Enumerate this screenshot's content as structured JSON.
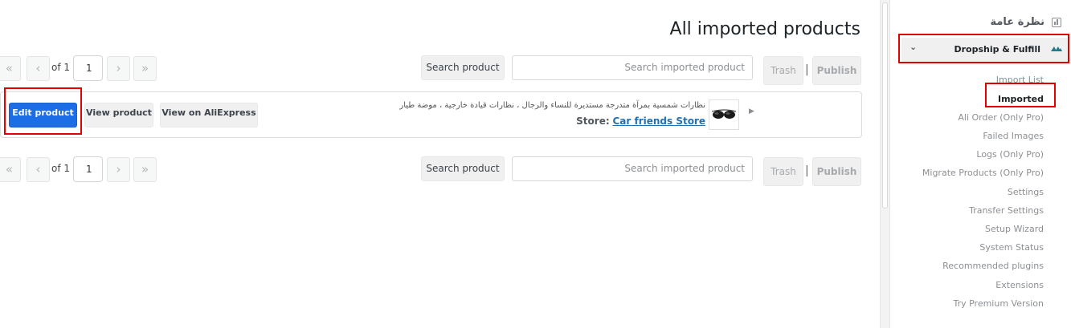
{
  "page": {
    "title": "All imported products"
  },
  "pagination": {
    "first": "«",
    "prev": "‹",
    "next": "›",
    "last": "»",
    "of_label": "of 1",
    "current_page": "1"
  },
  "toolbar": {
    "search_button": "Search product",
    "search_placeholder": "Search imported product",
    "trash_button": "Trash",
    "separator": "|",
    "publish_button": "Publish"
  },
  "product": {
    "title": "نظارات شمسية بمرآة متدرجة مستديرة للنساء والرجال ، نظارات قيادة خارجية ، موضة طيار",
    "store_label": "Store:",
    "store_name": "Car friends Store",
    "edit_button": "Edit product",
    "view_button": "View product",
    "aliexpress_button": "View on AliExpress",
    "thumbnail_icon": "sunglasses-image"
  },
  "sidebar": {
    "overview": "نظرة عامة",
    "plugin_menu": "Dropship & Fulfill",
    "items": [
      {
        "label": "Import List",
        "active": false
      },
      {
        "label": "Imported",
        "active": true
      },
      {
        "label": "Ali Order (Only Pro)",
        "active": false
      },
      {
        "label": "Failed Images",
        "active": false
      },
      {
        "label": "Logs (Only Pro)",
        "active": false
      },
      {
        "label": "Migrate Products (Only Pro)",
        "active": false
      },
      {
        "label": "Settings",
        "active": false
      },
      {
        "label": "Transfer Settings",
        "active": false
      },
      {
        "label": "Setup Wizard",
        "active": false
      },
      {
        "label": "System Status",
        "active": false
      },
      {
        "label": "Recommended plugins",
        "active": false
      },
      {
        "label": "Extensions",
        "active": false
      },
      {
        "label": "Try Premium Version",
        "active": false
      }
    ]
  },
  "colors": {
    "primary_button": "#1d6ee6",
    "highlight_box": "#e20000",
    "link": "#2271b1"
  }
}
